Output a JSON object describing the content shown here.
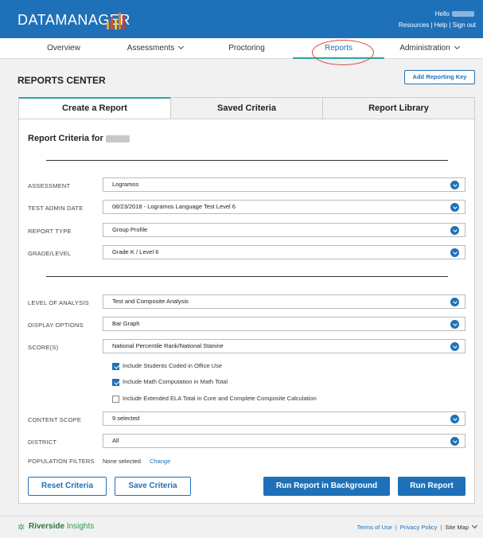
{
  "header": {
    "logo_text": "DATAMANAGER",
    "greeting": "Hello",
    "links": [
      "Resources",
      "Help",
      "Sign out"
    ],
    "brand_color": "#1e71b8"
  },
  "nav": {
    "items": [
      {
        "label": "Overview"
      },
      {
        "label": "Assessments"
      },
      {
        "label": "Proctoring"
      },
      {
        "label": "Reports"
      },
      {
        "label": "Administration"
      }
    ],
    "active": "Reports"
  },
  "page": {
    "title": "REPORTS CENTER",
    "add_key_label": "Add Reporting Key"
  },
  "tabs": [
    "Create a Report",
    "Saved Criteria",
    "Report Library"
  ],
  "form": {
    "title": "Report Criteria for",
    "fields": [
      {
        "label": "ASSESSMENT",
        "value": "Logramos"
      },
      {
        "label": "TEST ADMIN DATE",
        "value": "08/23/2018 - Logramos Language Test Level 6"
      },
      {
        "label": "REPORT TYPE",
        "value": "Group Profile"
      },
      {
        "label": "GRADE/LEVEL",
        "value": "Grade K / Level 6"
      },
      {
        "label": "LEVEL OF ANALYSIS",
        "value": "Test and Composite Analysis"
      },
      {
        "label": "DISPLAY OPTIONS",
        "value": "Bar Graph"
      },
      {
        "label": "SCORE(S)",
        "value": "National Percentile Rank/National Stanine"
      },
      {
        "label": "CONTENT SCOPE",
        "value": "9 selected"
      },
      {
        "label": "DISTRICT",
        "value": "All"
      }
    ],
    "checkboxes": [
      {
        "label": "Include Students Coded in Office Use",
        "checked": true
      },
      {
        "label": "Include Math Computation in Math Total",
        "checked": true
      },
      {
        "label": "Include Extended ELA Total in Core and Complete Composite Calculation",
        "checked": false
      }
    ],
    "population": {
      "label": "POPULATION FILTERS",
      "value": "None selected",
      "change": "Change"
    }
  },
  "buttons": {
    "reset": "Reset Criteria",
    "save": "Save Criteria",
    "run_bg": "Run Report in Background",
    "run": "Run Report"
  },
  "footer": {
    "brand": "Riverside",
    "brand_suffix": "Insights",
    "links": [
      "Terms of Use",
      "Privacy Policy",
      "Site Map"
    ]
  }
}
